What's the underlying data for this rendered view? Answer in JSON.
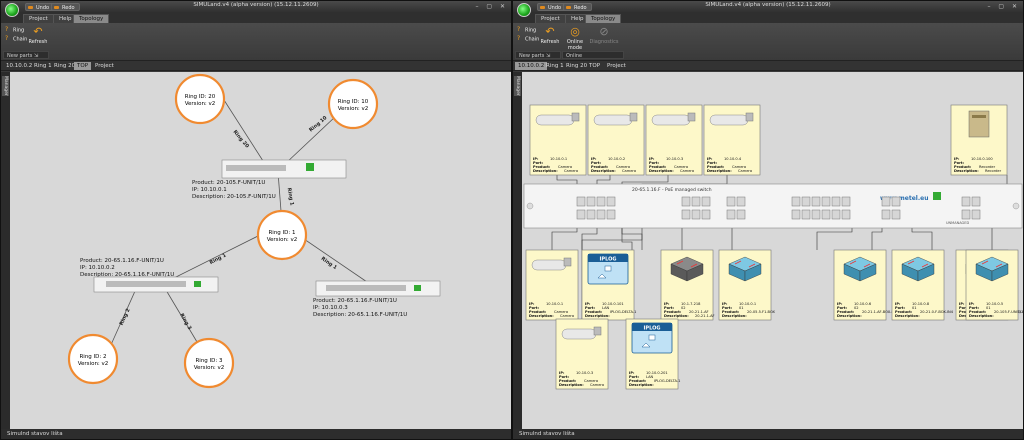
{
  "window_title": "SIMULand.v4 (alpha version) (15.12.11.2609)",
  "quick_access": {
    "undo": "Undo",
    "redo": "Redo"
  },
  "tabs": [
    "Project",
    "Help",
    "Topology"
  ],
  "active_tab": "Topology",
  "status_text": "Simulnd stavov lišta",
  "sidebar_tab": "Manager",
  "left": {
    "ribbon": {
      "ring": "Ring",
      "chain": "Chain",
      "refresh": "Refresh",
      "group": "New parts"
    },
    "breadcrumbs": [
      "10.10.0.2",
      "Ring 1",
      "Ring 20",
      "TOP",
      "Project"
    ],
    "active_crumb": "TOP",
    "rings": [
      {
        "id": "Ring ID: 20",
        "version": "Version: v2"
      },
      {
        "id": "Ring ID: 10",
        "version": "Version: v2"
      },
      {
        "id": "Ring ID: 1",
        "version": "Version: v2"
      },
      {
        "id": "Ring ID: 2",
        "version": "Version: v2"
      },
      {
        "id": "Ring ID: 3",
        "version": "Version: v2"
      }
    ],
    "link_labels": [
      "Ring 20",
      "Ring 10",
      "Ring 1",
      "Ring 1",
      "Ring 1",
      "Ring 2",
      "Ring 3"
    ],
    "devices": [
      {
        "product": "Product: 20-105.F-UNIT/1U",
        "ip": "IP: 10.10.0.1",
        "desc": "Description: 20-105.F-UNIT/1U"
      },
      {
        "product": "Product: 20-65.1.16.F-UNIT/1U",
        "ip": "IP: 10.10.0.2",
        "desc": "Description: 20-65.1.16.F-UNIT/1U"
      },
      {
        "product": "Product: 20-65.1.16.F-UNIT/1U",
        "ip": "IP: 10.10.0.3",
        "desc": "Description: 20-65.1.16.F-UNIT/1U"
      }
    ]
  },
  "right": {
    "ribbon": {
      "ring": "Ring",
      "chain": "Chain",
      "refresh": "Refresh",
      "online_mode": "Online mode",
      "diagnostics": "Diagnostics",
      "group1": "New parts",
      "group2": "Online synchronization"
    },
    "breadcrumbs": [
      "10.10.0.2",
      "Ring 1",
      "Ring 20",
      "TOP",
      "Project"
    ],
    "active_crumb": "10.10.0.2",
    "switch": {
      "title": "20-65.1.16.F - PoE managed switch",
      "brand": "www.metel.eu",
      "ports_label": "UNMANAGED"
    },
    "top_cards": [
      {
        "ip": "10.10.0.1",
        "port": "",
        "product": "Camera",
        "desc": "Camera"
      },
      {
        "ip": "10.10.0.2",
        "port": "",
        "product": "Camera",
        "desc": "Camera"
      },
      {
        "ip": "10.10.0.3",
        "port": "",
        "product": "Camera",
        "desc": "Camera"
      },
      {
        "ip": "10.10.0.4",
        "port": "",
        "product": "Camera",
        "desc": "Camera"
      },
      {
        "ip": "10.10.0.100",
        "port": "",
        "product": "Recorder",
        "desc": "Recorder"
      }
    ],
    "bottom_cards": [
      {
        "ip": "10.10.0.1",
        "port": "",
        "product": "Camera",
        "desc": "Camera",
        "kind": "camera"
      },
      {
        "ip": "10.10.0.101",
        "port": "LAN",
        "product": "IPLOG-DELTA-1",
        "desc": "",
        "kind": "iplog"
      },
      {
        "ip": "10.1.7.218",
        "port": "02",
        "product": "20-21.1-AF",
        "desc": "20-21.1-AF",
        "kind": "switch-gray"
      },
      {
        "ip": "10.10.0.1",
        "port": "01",
        "product": "20-05.5.F1-BOX",
        "desc": "",
        "kind": "switch"
      },
      {
        "ip": "10.10.0.6",
        "port": "02",
        "product": "20-21.1-AF-BOX-IN4-AF",
        "desc": "",
        "kind": "switch"
      },
      {
        "ip": "10.10.0.8",
        "port": "01",
        "product": "20-21.0-F-BOX-IN4",
        "desc": "",
        "kind": "switch"
      },
      {
        "ip": "10.10.0.4",
        "port": "03",
        "product": "20-65.1.16.F-UNIT/1U",
        "desc": "",
        "kind": "switch"
      },
      {
        "ip": "10.10.0.5",
        "port": "01",
        "product": "20-105.F-UNIT/1U",
        "desc": "",
        "kind": "switch"
      },
      {
        "ip": "10.10.0.3",
        "port": "",
        "product": "Camera",
        "desc": "Camera",
        "kind": "camera"
      },
      {
        "ip": "10.10.0.201",
        "port": "LAN",
        "product": "IPLOG-DELTA-1",
        "desc": "",
        "kind": "iplog"
      }
    ],
    "iplog_label": "IPLOG",
    "field_labels": {
      "ip": "IP:",
      "port": "Port:",
      "product": "Product:",
      "desc": "Description:"
    }
  }
}
